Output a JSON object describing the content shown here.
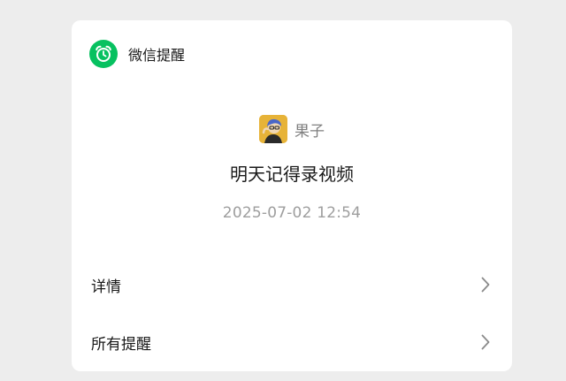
{
  "header": {
    "app_icon": "alarm-clock-icon",
    "app_name": "微信提醒"
  },
  "reminder": {
    "sender_name": "果子",
    "text": "明天记得录视频",
    "time": "2025-07-02 12:54"
  },
  "actions": {
    "detail_label": "详情",
    "all_reminders_label": "所有提醒"
  },
  "colors": {
    "brand_green": "#07c160",
    "card_bg": "#ffffff",
    "page_bg": "#ededed"
  }
}
